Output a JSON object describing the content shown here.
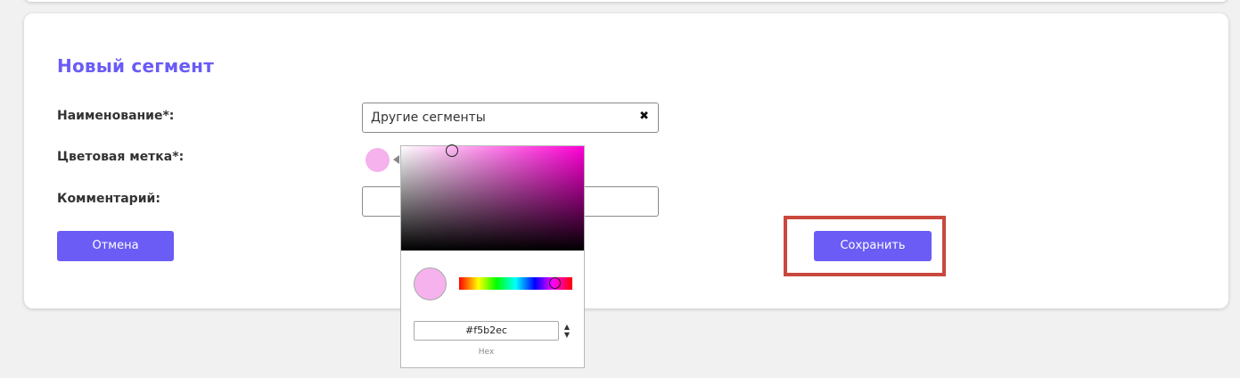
{
  "form": {
    "title": "Новый сегмент",
    "name_label": "Наименование*:",
    "name_value": "Другие сегменты",
    "clear_icon": "✖",
    "color_label": "Цветовая метка*:",
    "comment_label": "Комментарий:",
    "comment_value": "",
    "cancel_label": "Отмена",
    "save_label": "Сохранить"
  },
  "color_picker": {
    "selected_color": "#f5b2ec",
    "hex_value": "#f5b2ec",
    "hex_label": "Hex",
    "toggle_up": "▲",
    "toggle_down": "▼"
  },
  "colors": {
    "accent": "#6a5cf5",
    "highlight": "#c9483d"
  }
}
